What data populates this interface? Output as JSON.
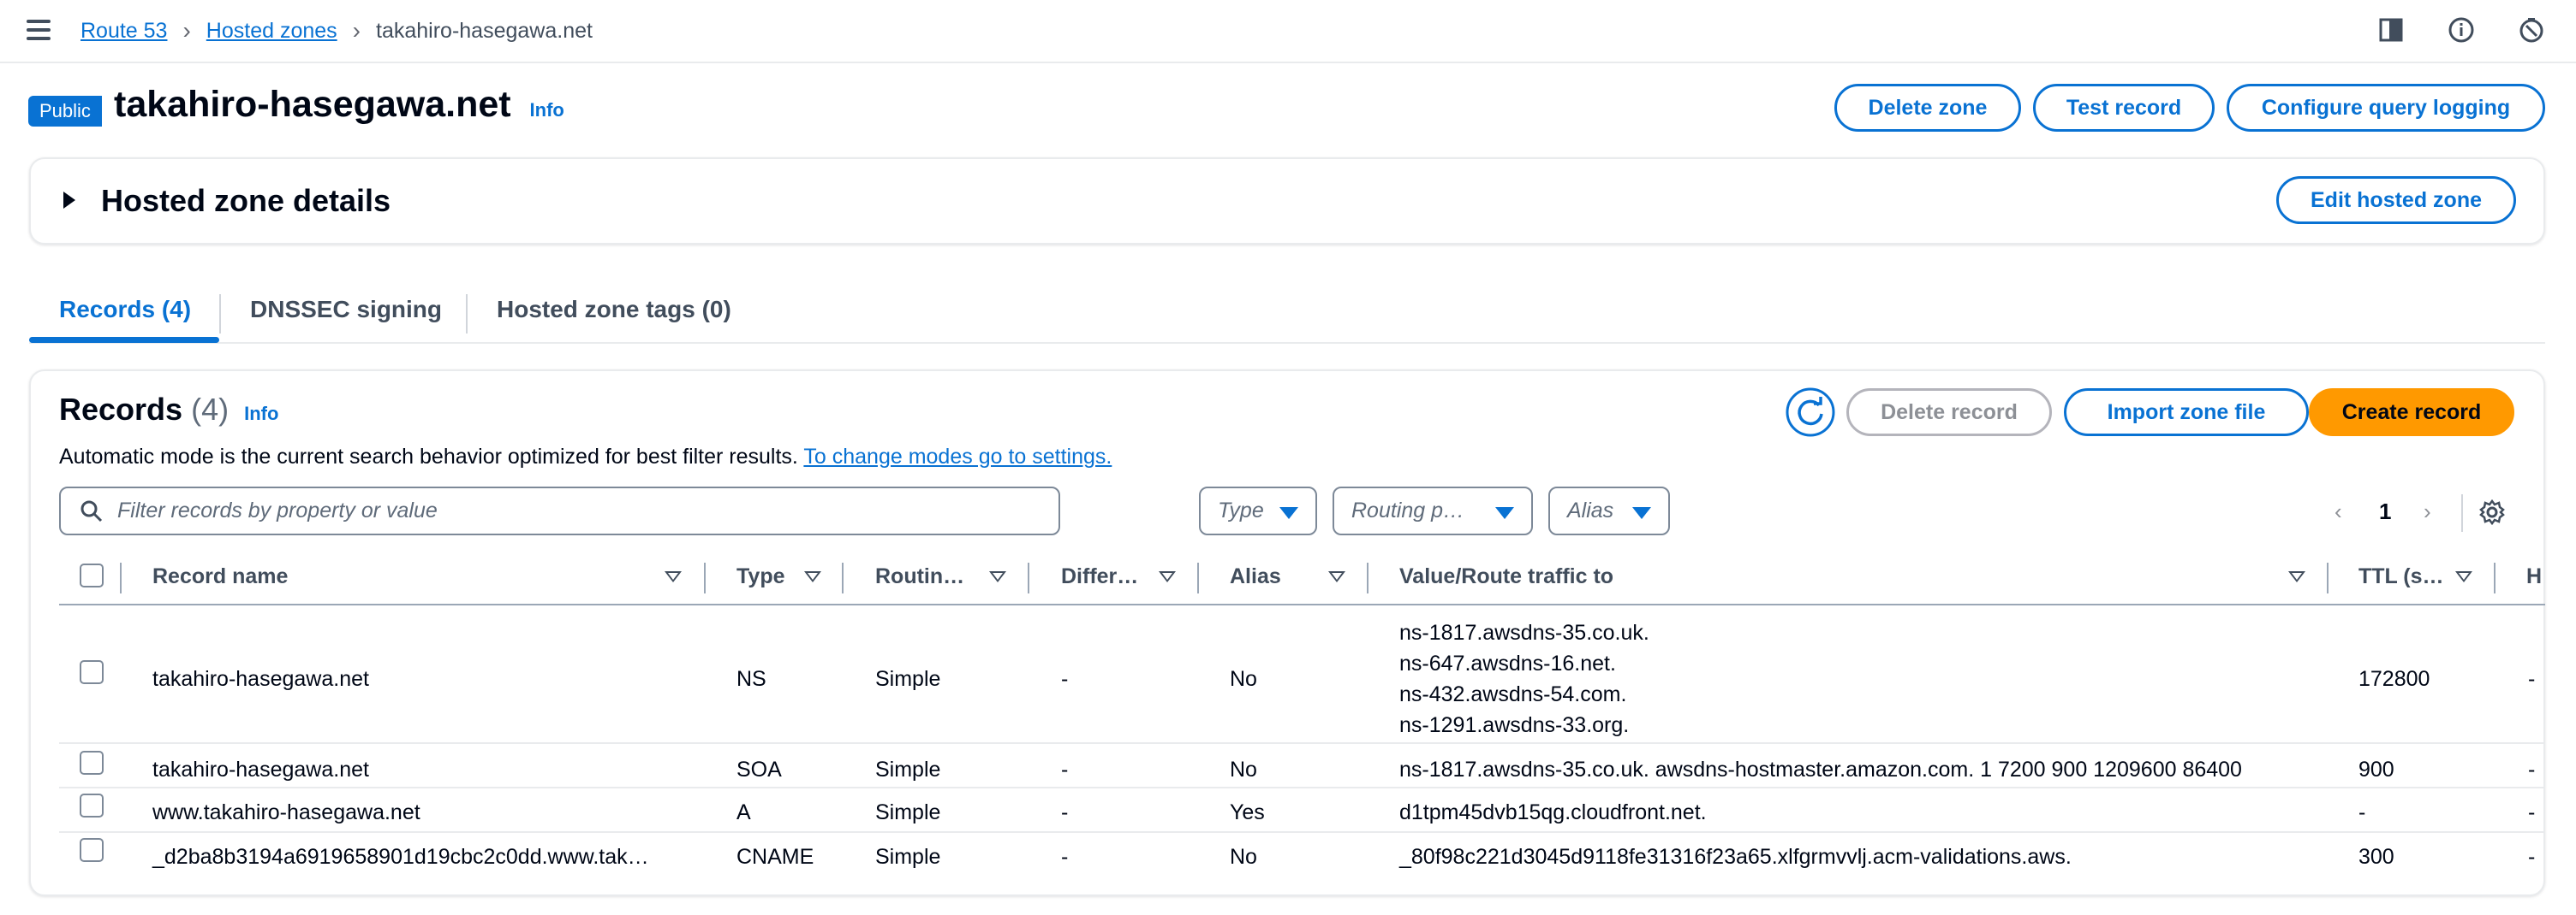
{
  "breadcrumb": {
    "root": "Route 53",
    "parent": "Hosted zones",
    "current": "takahiro-hasegawa.net"
  },
  "icons": {
    "menu": "menu-icon",
    "panel": "side-panel-icon",
    "info": "info-circle-icon",
    "notifications": "notifications-icon",
    "refresh": "refresh-icon",
    "search": "search-icon",
    "settings": "gear-icon"
  },
  "header": {
    "badge": "Public",
    "title": "takahiro-hasegawa.net",
    "info": "Info",
    "delete_zone": "Delete zone",
    "test_record": "Test record",
    "configure_logging": "Configure query logging"
  },
  "details": {
    "title": "Hosted zone details",
    "edit_button": "Edit hosted zone"
  },
  "tabs": [
    {
      "label": "Records (4)"
    },
    {
      "label": "DNSSEC signing"
    },
    {
      "label": "Hosted zone tags (0)"
    }
  ],
  "records_panel": {
    "title": "Records",
    "count": "(4)",
    "info": "Info",
    "description": "Automatic mode is the current search behavior optimized for best filter results.",
    "description_link": "To change modes go to settings.",
    "delete_record": "Delete record",
    "import_zone_file": "Import zone file",
    "create_record": "Create record",
    "search_placeholder": "Filter records by property or value",
    "filters": {
      "type": "Type",
      "routing": "Routing p…",
      "alias": "Alias"
    },
    "page": "1"
  },
  "table": {
    "columns": {
      "name": "Record name",
      "type": "Type",
      "routing": "Routin…",
      "differ": "Differ…",
      "alias": "Alias",
      "value": "Value/Route traffic to",
      "ttl": "TTL (s…",
      "h": "H"
    },
    "rows": [
      {
        "name": "takahiro-hasegawa.net",
        "type": "NS",
        "routing": "Simple",
        "differ": "-",
        "alias": "No",
        "values": [
          "ns-1817.awsdns-35.co.uk.",
          "ns-647.awsdns-16.net.",
          "ns-432.awsdns-54.com.",
          "ns-1291.awsdns-33.org."
        ],
        "ttl": "172800",
        "h": "-"
      },
      {
        "name": "takahiro-hasegawa.net",
        "type": "SOA",
        "routing": "Simple",
        "differ": "-",
        "alias": "No",
        "values": [
          "ns-1817.awsdns-35.co.uk. awsdns-hostmaster.amazon.com. 1 7200 900 1209600 86400"
        ],
        "ttl": "900",
        "h": "-"
      },
      {
        "name": "www.takahiro-hasegawa.net",
        "type": "A",
        "routing": "Simple",
        "differ": "-",
        "alias": "Yes",
        "values": [
          "d1tpm45dvb15qg.cloudfront.net."
        ],
        "ttl": "-",
        "h": "-"
      },
      {
        "name": "_d2ba8b3194a6919658901d19cbc2c0dd.www.tak…",
        "type": "CNAME",
        "routing": "Simple",
        "differ": "-",
        "alias": "No",
        "values": [
          "_80f98c221d3045d9118fe31316f23a65.xlfgrmvvlj.acm-validations.aws."
        ],
        "ttl": "300",
        "h": "-"
      }
    ]
  }
}
